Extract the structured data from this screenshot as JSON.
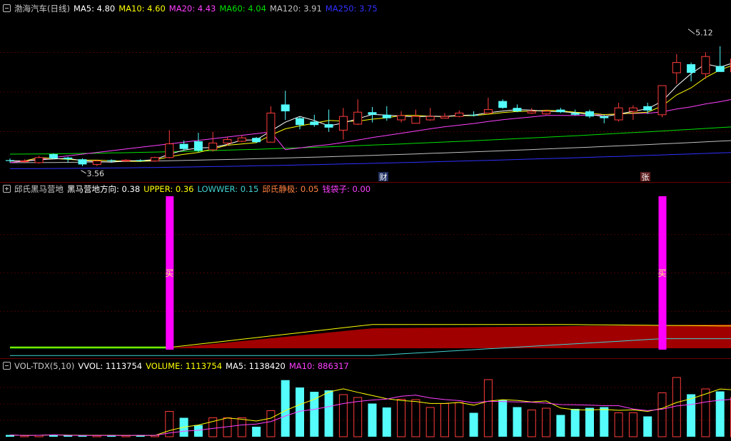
{
  "colors": {
    "up": "#ff3b3b",
    "down": "#54fcfc",
    "ma5": "#ffffff",
    "ma10": "#ffff00",
    "ma20": "#ff40ff",
    "ma60": "#00e000",
    "ma120": "#c0c0c0",
    "ma250": "#3030ff",
    "signal": "#ff00ff",
    "fill": "#a00000",
    "upper": "#ffff00",
    "lower": "#40d0d0"
  },
  "panels": [
    {
      "id": "price",
      "icon": "minus-icon",
      "items": [
        {
          "text": "渤海汽车(日线)",
          "color": "#c8c8c8"
        },
        {
          "text": "MA5: 4.80",
          "color": "#ffffff"
        },
        {
          "text": "MA10: 4.60",
          "color": "#ffff00"
        },
        {
          "text": "MA20: 4.43",
          "color": "#ff40ff"
        },
        {
          "text": "MA60: 4.04",
          "color": "#00e000"
        },
        {
          "text": "MA120: 3.91",
          "color": "#c0c0c0"
        },
        {
          "text": "MA250: 3.75",
          "color": "#3030ff"
        }
      ]
    },
    {
      "id": "ind",
      "icon": "plus-icon",
      "items": [
        {
          "text": "邱氏黑马营地",
          "color": "#c8c8c8"
        },
        {
          "text": "黑马营地方向: 0.38",
          "color": "#ffffff"
        },
        {
          "text": "UPPER: 0.36",
          "color": "#ffff00"
        },
        {
          "text": "LOWWER: 0.15",
          "color": "#40d0d0"
        },
        {
          "text": "邱氏静极: 0.05",
          "color": "#ff8040"
        },
        {
          "text": "钱袋子: 0.00",
          "color": "#ff40ff"
        }
      ]
    },
    {
      "id": "vol",
      "icon": "minus-icon",
      "items": [
        {
          "text": "VOL-TDX(5,10)",
          "color": "#c8c8c8"
        },
        {
          "text": "VVOL: 1113754",
          "color": "#ffffff"
        },
        {
          "text": "VOLUME: 1113754",
          "color": "#ffff00"
        },
        {
          "text": "MA5: 1138420",
          "color": "#ffffff"
        },
        {
          "text": "MA10: 886317",
          "color": "#ff40ff"
        }
      ]
    }
  ],
  "annotations": {
    "high": "5.12",
    "low": "3.56",
    "marker_cai": "财",
    "marker_zhang": "张",
    "buy": "买"
  },
  "chart_data": {
    "type": "candlestick",
    "price_range": [
      3.5,
      5.35
    ],
    "candles": [
      [
        3.63,
        3.62,
        3.65,
        3.6
      ],
      [
        3.62,
        3.62,
        3.64,
        3.6
      ],
      [
        3.6,
        3.66,
        3.68,
        3.59
      ],
      [
        3.7,
        3.65,
        3.71,
        3.64
      ],
      [
        3.66,
        3.64,
        3.67,
        3.6
      ],
      [
        3.64,
        3.58,
        3.65,
        3.56
      ],
      [
        3.58,
        3.62,
        3.63,
        3.56
      ],
      [
        3.63,
        3.62,
        3.64,
        3.6
      ],
      [
        3.62,
        3.63,
        3.64,
        3.61
      ],
      [
        3.63,
        3.62,
        3.64,
        3.61
      ],
      [
        3.62,
        3.66,
        3.67,
        3.61
      ],
      [
        3.66,
        3.82,
        3.98,
        3.65
      ],
      [
        3.82,
        3.76,
        3.86,
        3.74
      ],
      [
        3.85,
        3.74,
        3.95,
        3.72
      ],
      [
        3.75,
        3.83,
        3.96,
        3.73
      ],
      [
        3.83,
        3.87,
        3.9,
        3.8
      ],
      [
        3.85,
        3.89,
        3.92,
        3.84
      ],
      [
        3.89,
        3.84,
        3.9,
        3.83
      ],
      [
        3.84,
        4.18,
        4.26,
        3.84
      ],
      [
        4.28,
        4.2,
        4.44,
        4.1
      ],
      [
        4.12,
        4.04,
        4.14,
        3.99
      ],
      [
        4.08,
        4.04,
        4.16,
        4.02
      ],
      [
        4.05,
        4.01,
        4.22,
        3.96
      ],
      [
        3.98,
        4.14,
        4.24,
        3.87
      ],
      [
        4.05,
        4.19,
        4.34,
        4.04
      ],
      [
        4.19,
        4.16,
        4.25,
        4.07
      ],
      [
        4.16,
        4.12,
        4.26,
        4.09
      ],
      [
        4.1,
        4.15,
        4.2,
        4.07
      ],
      [
        4.06,
        4.14,
        4.22,
        4.06
      ],
      [
        4.1,
        4.14,
        4.24,
        4.09
      ],
      [
        4.12,
        4.14,
        4.18,
        4.12
      ],
      [
        4.14,
        4.18,
        4.21,
        4.13
      ],
      [
        4.16,
        4.15,
        4.2,
        4.14
      ],
      [
        4.18,
        4.22,
        4.36,
        4.18
      ],
      [
        4.32,
        4.24,
        4.34,
        4.23
      ],
      [
        4.24,
        4.2,
        4.28,
        4.19
      ],
      [
        4.18,
        4.2,
        4.24,
        4.17
      ],
      [
        4.17,
        4.2,
        4.22,
        4.16
      ],
      [
        4.22,
        4.19,
        4.24,
        4.18
      ],
      [
        4.18,
        4.16,
        4.22,
        4.15
      ],
      [
        4.2,
        4.14,
        4.22,
        4.12
      ],
      [
        4.14,
        4.12,
        4.16,
        4.06
      ],
      [
        4.1,
        4.24,
        4.3,
        4.08
      ],
      [
        4.2,
        4.24,
        4.27,
        4.1
      ],
      [
        4.26,
        4.21,
        4.3,
        4.17
      ],
      [
        4.16,
        4.5,
        4.5,
        4.13
      ],
      [
        4.65,
        4.77,
        4.87,
        4.52
      ],
      [
        4.75,
        4.65,
        4.77,
        4.55
      ],
      [
        4.64,
        4.84,
        4.89,
        4.58
      ],
      [
        4.73,
        4.66,
        4.96,
        4.66
      ],
      [
        4.66,
        4.81,
        5.03,
        4.58
      ]
    ],
    "volume_range": [
      0,
      9200
    ],
    "volumes": [
      250,
      180,
      200,
      260,
      200,
      180,
      170,
      180,
      180,
      170,
      200,
      3550,
      2650,
      1630,
      2650,
      2650,
      2650,
      1400,
      3650,
      7930,
      6900,
      6300,
      6500,
      5900,
      5500,
      4650,
      4100,
      5250,
      5200,
      4100,
      4650,
      4800,
      3350,
      8000,
      5150,
      4150,
      3750,
      4000,
      3050,
      3900,
      4050,
      4150,
      3350,
      3350,
      2850,
      6150,
      8300,
      5950,
      6700,
      6350,
      5500
    ],
    "indicator": {
      "range": [
        0,
        1
      ],
      "buy_signals": [
        11,
        45
      ]
    }
  }
}
